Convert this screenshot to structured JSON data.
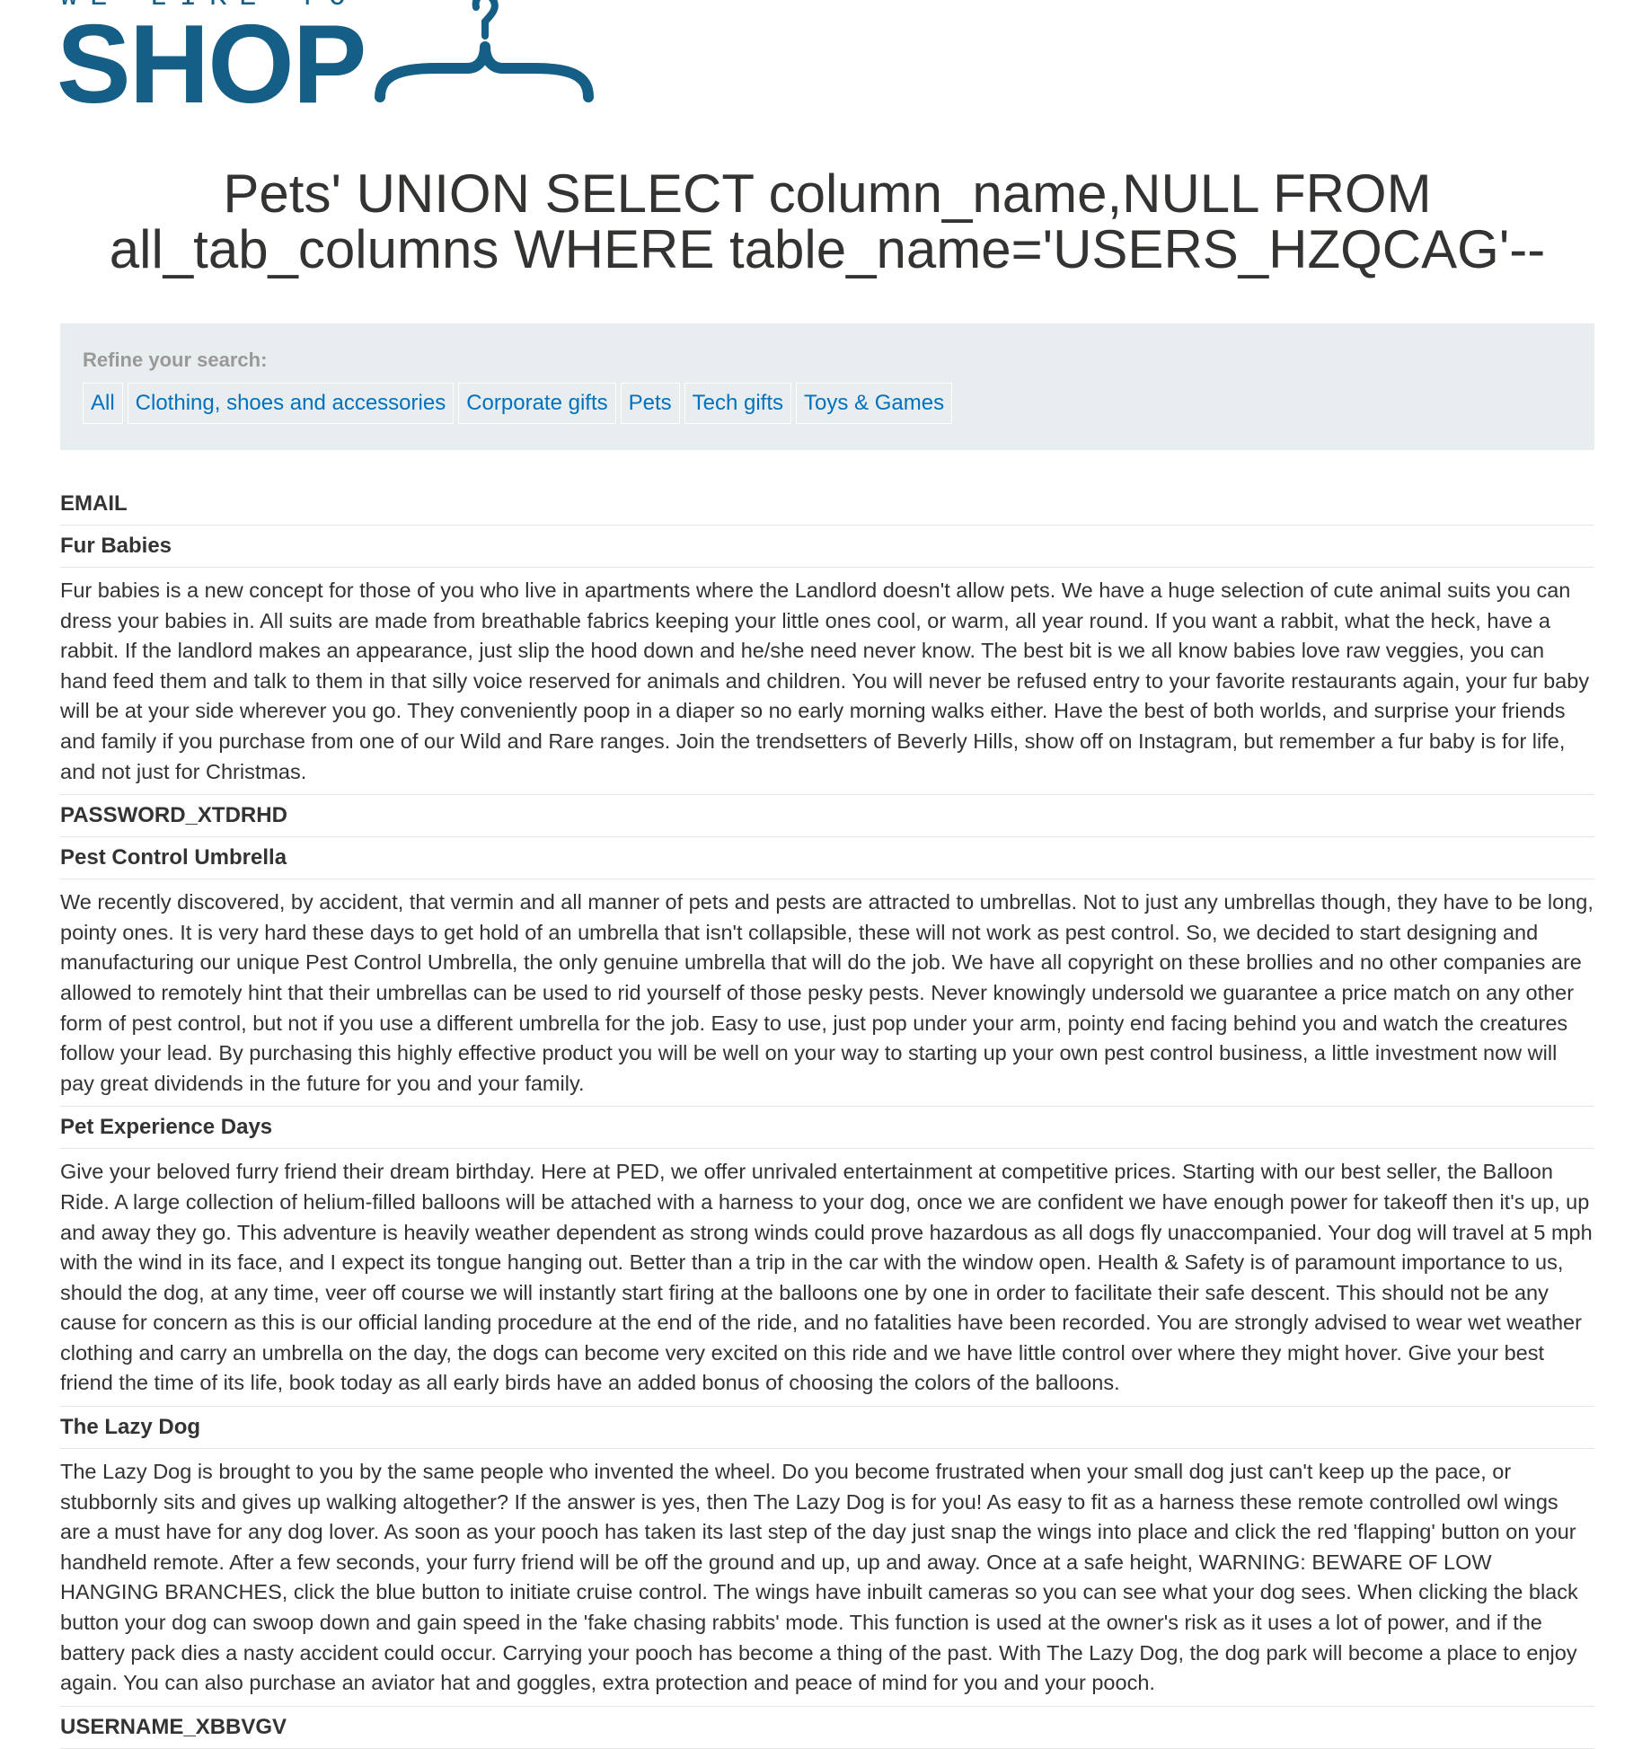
{
  "logo": {
    "top_text": "WE LIKE TO",
    "main_text": "SHOP"
  },
  "page_title": "Pets' UNION SELECT column_name,NULL FROM all_tab_columns WHERE table_name='USERS_HZQCAG'--",
  "filters": {
    "label": "Refine your search:",
    "links": [
      "All",
      "Clothing, shoes and accessories",
      "Corporate gifts",
      "Pets",
      "Tech gifts",
      "Toys & Games"
    ]
  },
  "colors": {
    "brand": "#155f86",
    "link": "#0071bc",
    "panel_bg": "#e8edf0"
  },
  "results": [
    {
      "name": "EMAIL",
      "description": ""
    },
    {
      "name": "Fur Babies",
      "description": "Fur babies is a new concept for those of you who live in apartments where the Landlord doesn't allow pets. We have a huge selection of cute animal suits you can dress your babies in. All suits are made from breathable fabrics keeping your little ones cool, or warm, all year round. If you want a rabbit, what the heck, have a rabbit. If the landlord makes an appearance, just slip the hood down and he/she need never know. The best bit is we all know babies love raw veggies, you can hand feed them and talk to them in that silly voice reserved for animals and children. You will never be refused entry to your favorite restaurants again, your fur baby will be at your side wherever you go. They conveniently poop in a diaper so no early morning walks either. Have the best of both worlds, and surprise your friends and family if you purchase from one of our Wild and Rare ranges. Join the trendsetters of Beverly Hills, show off on Instagram, but remember a fur baby is for life, and not just for Christmas."
    },
    {
      "name": "PASSWORD_XTDRHD",
      "description": ""
    },
    {
      "name": "Pest Control Umbrella",
      "description": "We recently discovered, by accident, that vermin and all manner of pets and pests are attracted to umbrellas. Not to just any umbrellas though, they have to be long, pointy ones. It is very hard these days to get hold of an umbrella that isn't collapsible, these will not work as pest control. So, we decided to start designing and manufacturing our unique Pest Control Umbrella, the only genuine umbrella that will do the job. We have all copyright on these brollies and no other companies are allowed to remotely hint that their umbrellas can be used to rid yourself of those pesky pests. Never knowingly undersold we guarantee a price match on any other form of pest control, but not if you use a different umbrella for the job. Easy to use, just pop under your arm, pointy end facing behind you and watch the creatures follow your lead. By purchasing this highly effective product you will be well on your way to starting up your own pest control business, a little investment now will pay great dividends in the future for you and your family."
    },
    {
      "name": "Pet Experience Days",
      "description": "Give your beloved furry friend their dream birthday. Here at PED, we offer unrivaled entertainment at competitive prices. Starting with our best seller, the Balloon Ride. A large collection of helium-filled balloons will be attached with a harness to your dog, once we are confident we have enough power for takeoff then it's up, up and away they go. This adventure is heavily weather dependent as strong winds could prove hazardous as all dogs fly unaccompanied. Your dog will travel at 5 mph with the wind in its face, and I expect its tongue hanging out. Better than a trip in the car with the window open. Health & Safety is of paramount importance to us, should the dog, at any time, veer off course we will instantly start firing at the balloons one by one in order to facilitate their safe descent. This should not be any cause for concern as this is our official landing procedure at the end of the ride, and no fatalities have been recorded. You are strongly advised to wear wet weather clothing and carry an umbrella on the day, the dogs can become very excited on this ride and we have little control over where they might hover. Give your best friend the time of its life, book today as all early birds have an added bonus of choosing the colors of the balloons."
    },
    {
      "name": "The Lazy Dog",
      "description": "The Lazy Dog is brought to you by the same people who invented the wheel. Do you become frustrated when your small dog just can't keep up the pace, or stubbornly sits and gives up walking altogether? If the answer is yes, then The Lazy Dog is for you! As easy to fit as a harness these remote controlled owl wings are a must have for any dog lover. As soon as your pooch has taken its last step of the day just snap the wings into place and click the red 'flapping' button on your handheld remote. After a few seconds, your furry friend will be off the ground and up, up and away. Once at a safe height, WARNING: BEWARE OF LOW HANGING BRANCHES, click the blue button to initiate cruise control. The wings have inbuilt cameras so you can see what your dog sees. When clicking the black button your dog can swoop down and gain speed in the 'fake chasing rabbits' mode. This function is used at the owner's risk as it uses a lot of power, and if the battery pack dies a nasty accident could occur. Carrying your pooch has become a thing of the past. With The Lazy Dog, the dog park will become a place to enjoy again. You can also purchase an aviator hat and goggles, extra protection and peace of mind for you and your pooch."
    },
    {
      "name": "USERNAME_XBBVGV",
      "description": ""
    }
  ]
}
